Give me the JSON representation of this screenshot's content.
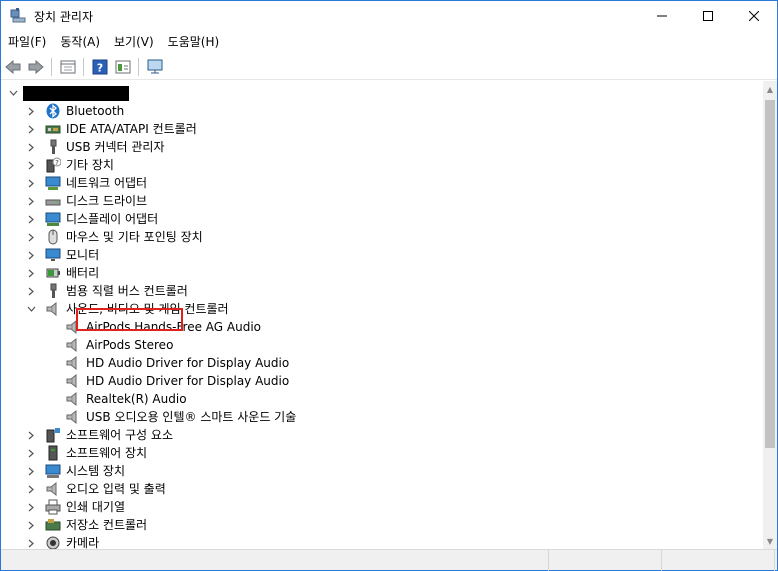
{
  "window": {
    "title": "장치 관리자",
    "controls": [
      "minimize",
      "maximize",
      "close"
    ]
  },
  "menu": [
    {
      "label": "파일(F)"
    },
    {
      "label": "동작(A)"
    },
    {
      "label": "보기(V)"
    },
    {
      "label": "도움말(H)"
    }
  ],
  "toolbar": [
    {
      "name": "back-button",
      "icon": "back-arrow-icon"
    },
    {
      "name": "forward-button",
      "icon": "forward-arrow-icon"
    },
    {
      "name": "properties-button",
      "icon": "properties-icon"
    },
    {
      "name": "help-button",
      "icon": "help-icon"
    },
    {
      "name": "view-button",
      "icon": "view-icon"
    },
    {
      "name": "scan-hardware-button",
      "icon": "monitor-scan-icon"
    }
  ],
  "tree": {
    "root_label": "",
    "categories": [
      {
        "label": "Bluetooth",
        "icon": "bluetooth-icon",
        "expanded": false
      },
      {
        "label": "IDE ATA/ATAPI 컨트롤러",
        "icon": "ide-controller-icon",
        "expanded": false
      },
      {
        "label": "USB 커넥터 관리자",
        "icon": "usb-icon",
        "expanded": false
      },
      {
        "label": "기타 장치",
        "icon": "unknown-device-icon",
        "expanded": false
      },
      {
        "label": "네트워크 어댑터",
        "icon": "network-adapter-icon",
        "expanded": false
      },
      {
        "label": "디스크 드라이브",
        "icon": "disk-drive-icon",
        "expanded": false
      },
      {
        "label": "디스플레이 어댑터",
        "icon": "display-adapter-icon",
        "expanded": false
      },
      {
        "label": "마우스 및 기타 포인팅 장치",
        "icon": "mouse-icon",
        "expanded": false
      },
      {
        "label": "모니터",
        "icon": "monitor-icon",
        "expanded": false
      },
      {
        "label": "배터리",
        "icon": "battery-icon",
        "expanded": false
      },
      {
        "label": "범용 직렬 버스 컨트롤러",
        "icon": "usb-icon",
        "expanded": false
      },
      {
        "label": "사운드, 비디오 및 게임 컨트롤러",
        "icon": "speaker-icon",
        "expanded": true,
        "children": [
          {
            "label": "AirPods Hands-Free AG Audio",
            "icon": "speaker-icon"
          },
          {
            "label": "AirPods Stereo",
            "icon": "speaker-icon"
          },
          {
            "label": "HD Audio Driver for Display Audio",
            "icon": "speaker-icon"
          },
          {
            "label": "HD Audio Driver for Display Audio",
            "icon": "speaker-icon"
          },
          {
            "label": "Realtek(R) Audio",
            "icon": "speaker-icon",
            "highlighted": true
          },
          {
            "label": "USB 오디오용 인텔® 스마트 사운드 기술",
            "icon": "speaker-icon"
          }
        ]
      },
      {
        "label": "소프트웨어 구성 요소",
        "icon": "software-component-icon",
        "expanded": false
      },
      {
        "label": "소프트웨어 장치",
        "icon": "software-device-icon",
        "expanded": false
      },
      {
        "label": "시스템 장치",
        "icon": "system-device-icon",
        "expanded": false
      },
      {
        "label": "오디오 입력 및 출력",
        "icon": "speaker-icon",
        "expanded": false
      },
      {
        "label": "인쇄 대기열",
        "icon": "printer-icon",
        "expanded": false
      },
      {
        "label": "저장소 컨트롤러",
        "icon": "storage-controller-icon",
        "expanded": false
      },
      {
        "label": "카메라",
        "icon": "camera-icon",
        "expanded": false
      }
    ]
  },
  "colors": {
    "highlight_border": "#e0221e",
    "titlebar_border": "#2b79d7",
    "icon_blue": "#1e73c8"
  }
}
